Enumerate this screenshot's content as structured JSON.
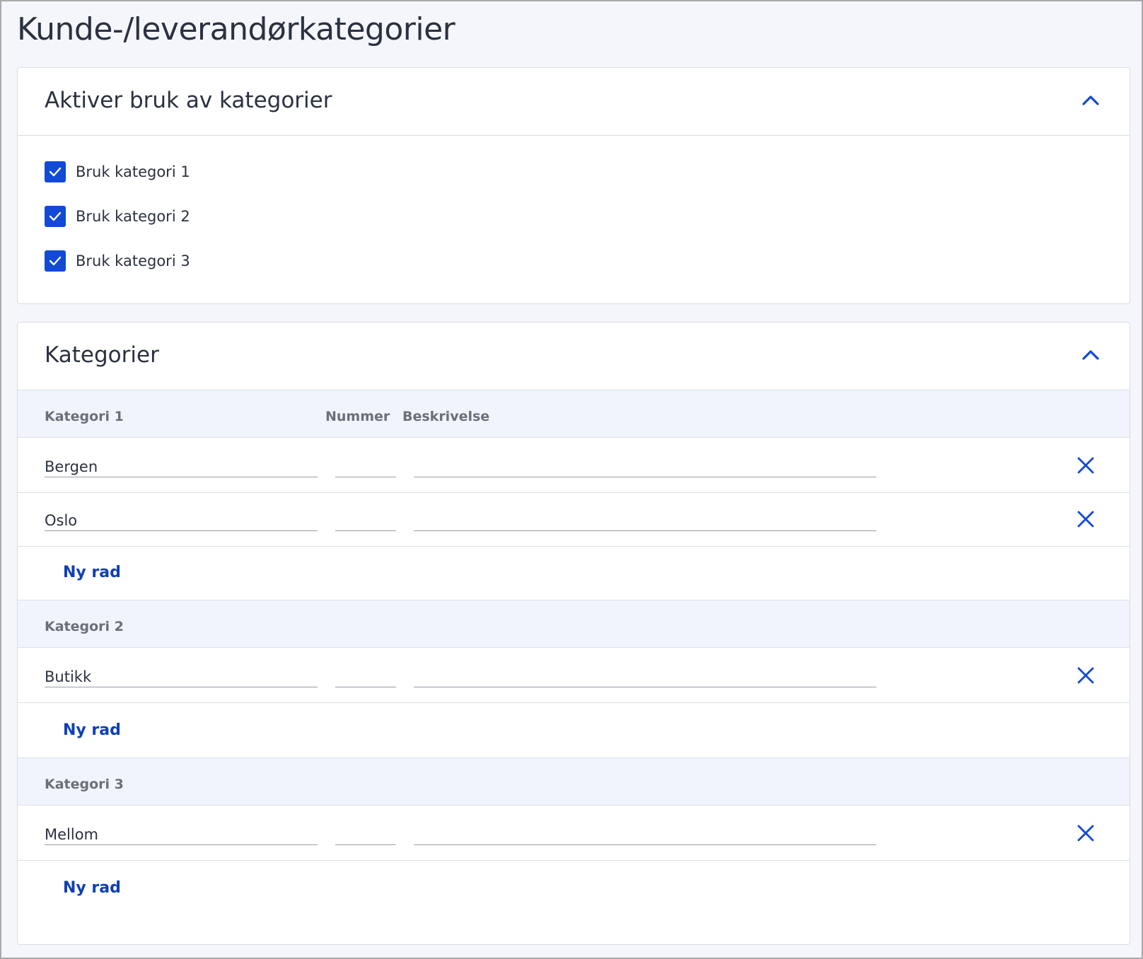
{
  "page": {
    "title": "Kunde-/leverandørkategorier"
  },
  "activate_panel": {
    "title": "Aktiver bruk av kategorier",
    "checkboxes": [
      {
        "label": "Bruk kategori 1",
        "checked": true
      },
      {
        "label": "Bruk kategori 2",
        "checked": true
      },
      {
        "label": "Bruk kategori 3",
        "checked": true
      }
    ]
  },
  "categories_panel": {
    "title": "Kategorier",
    "columns": {
      "number": "Nummer",
      "description": "Beskrivelse"
    },
    "add_row_label": "Ny rad",
    "groups": [
      {
        "title": "Kategori 1",
        "rows": [
          {
            "name": "Bergen",
            "number": "",
            "description": ""
          },
          {
            "name": "Oslo",
            "number": "",
            "description": ""
          }
        ]
      },
      {
        "title": "Kategori 2",
        "rows": [
          {
            "name": "Butikk",
            "number": "",
            "description": ""
          }
        ]
      },
      {
        "title": "Kategori 3",
        "rows": [
          {
            "name": "Mellom",
            "number": "",
            "description": ""
          }
        ]
      }
    ]
  },
  "icons": {
    "collapse": "chevron-up-icon",
    "delete": "close-icon",
    "checkbox": "check-icon"
  },
  "colors": {
    "accent": "#1249d6",
    "link": "#0f3fb3",
    "group_header_bg": "#f1f4fc",
    "page_bg": "#f5f6fb"
  }
}
